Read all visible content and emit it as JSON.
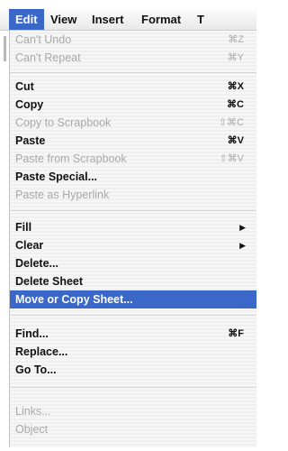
{
  "menubar": {
    "items": [
      {
        "label": "Edit",
        "active": true
      },
      {
        "label": "View",
        "active": false
      },
      {
        "label": "Insert",
        "active": false
      },
      {
        "label": "Format",
        "active": false
      },
      {
        "label": "T",
        "active": false
      }
    ]
  },
  "colors": {
    "highlight": "#3a67c8",
    "disabled_text": "#a9a9a9",
    "text": "#111111"
  },
  "menu": {
    "items": [
      {
        "label": "Can't Undo",
        "shortcut": "⌘Z",
        "enabled": false
      },
      {
        "label": "Can't Repeat",
        "shortcut": "⌘Y",
        "enabled": false
      },
      {
        "label": "Cut",
        "shortcut": "⌘X",
        "enabled": true
      },
      {
        "label": "Copy",
        "shortcut": "⌘C",
        "enabled": true
      },
      {
        "label": "Copy to Scrapbook",
        "shortcut": "⇧⌘C",
        "enabled": false
      },
      {
        "label": "Paste",
        "shortcut": "⌘V",
        "enabled": true
      },
      {
        "label": "Paste from Scrapbook",
        "shortcut": "⇧⌘V",
        "enabled": false
      },
      {
        "label": "Paste Special...",
        "shortcut": "",
        "enabled": true
      },
      {
        "label": "Paste as Hyperlink",
        "shortcut": "",
        "enabled": false
      },
      {
        "label": "Fill",
        "submenu": true,
        "enabled": true
      },
      {
        "label": "Clear",
        "submenu": true,
        "enabled": true
      },
      {
        "label": "Delete...",
        "shortcut": "",
        "enabled": true
      },
      {
        "label": "Delete Sheet",
        "shortcut": "",
        "enabled": true
      },
      {
        "label": "Move or Copy Sheet...",
        "shortcut": "",
        "enabled": true,
        "highlighted": true
      },
      {
        "label": "Find...",
        "shortcut": "⌘F",
        "enabled": true
      },
      {
        "label": "Replace...",
        "shortcut": "",
        "enabled": true
      },
      {
        "label": "Go To...",
        "shortcut": "",
        "enabled": true
      },
      {
        "label": "Links...",
        "shortcut": "",
        "enabled": false
      },
      {
        "label": "Object",
        "shortcut": "",
        "enabled": false
      }
    ]
  }
}
